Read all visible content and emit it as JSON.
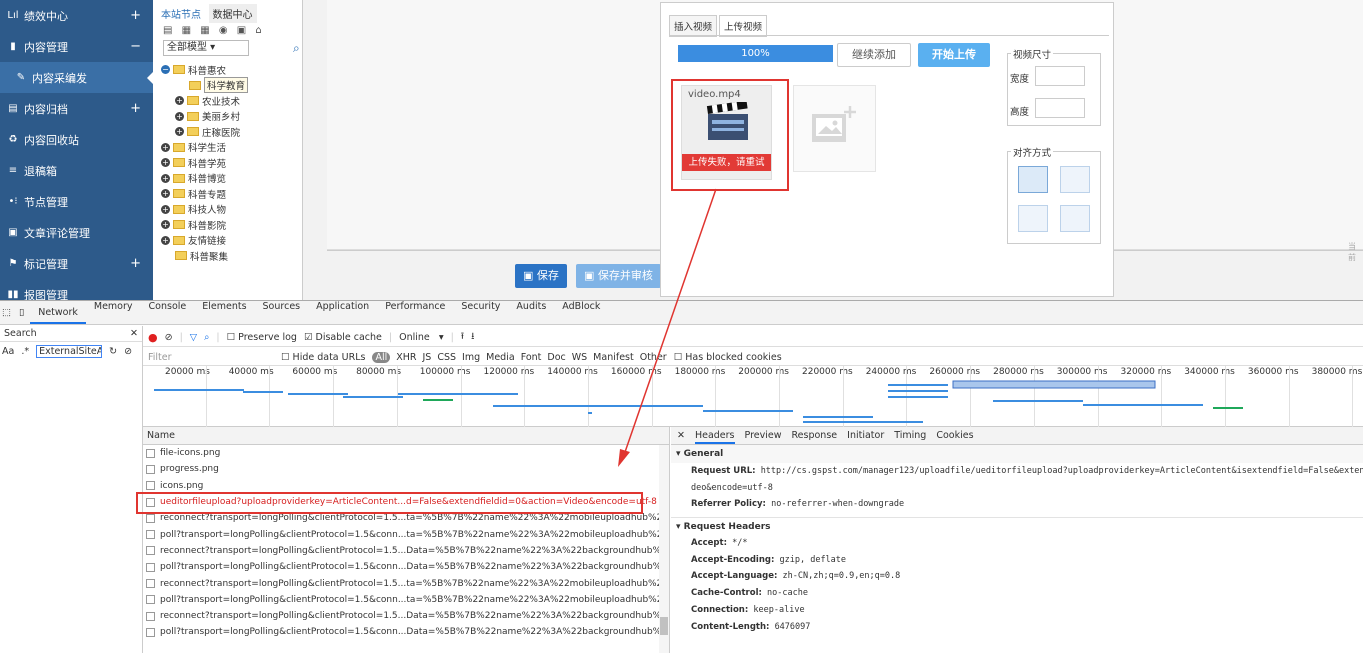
{
  "nav": {
    "items": [
      {
        "icon": "bar-chart-icon",
        "glyph": "Lıl",
        "label": "绩效中心",
        "toggle": "+"
      },
      {
        "icon": "book-icon",
        "glyph": "▮",
        "label": "内容管理",
        "toggle": "−"
      },
      {
        "icon": "wrench-icon",
        "glyph": "✎",
        "label": "内容采编发",
        "toggle": ""
      },
      {
        "icon": "archive-icon",
        "glyph": "▤",
        "label": "内容归档",
        "toggle": "+"
      },
      {
        "icon": "recycle-icon",
        "glyph": "♻",
        "label": "内容回收站",
        "toggle": ""
      },
      {
        "icon": "return-box-icon",
        "glyph": "≡",
        "label": "退稿箱",
        "toggle": ""
      },
      {
        "icon": "node-icon",
        "glyph": "•⁝",
        "label": "节点管理",
        "toggle": ""
      },
      {
        "icon": "comment-icon",
        "glyph": "▣",
        "label": "文章评论管理",
        "toggle": ""
      },
      {
        "icon": "flag-icon",
        "glyph": "⚑",
        "label": "标记管理",
        "toggle": "+"
      },
      {
        "icon": "report-icon",
        "glyph": "▮▮",
        "label": "报图管理",
        "toggle": ""
      }
    ]
  },
  "tree": {
    "tabs": [
      "本站节点",
      "数据中心"
    ],
    "tool_glyphs": "▤ ▦ ▦ ◉ ▣ ⌂",
    "model_select": "全部模型",
    "nodes": [
      {
        "label": "科普惠农",
        "btn": "−",
        "indent": 0
      },
      {
        "label": "科学教育",
        "btn": "",
        "indent": 2
      },
      {
        "label": "农业技术",
        "btn": "+",
        "indent": 1
      },
      {
        "label": "美丽乡村",
        "btn": "+",
        "indent": 1
      },
      {
        "label": "庄稼医院",
        "btn": "+",
        "indent": 1
      },
      {
        "label": "科学生活",
        "btn": "+",
        "indent": 0
      },
      {
        "label": "科普学苑",
        "btn": "+",
        "indent": 0
      },
      {
        "label": "科普博览",
        "btn": "+",
        "indent": 0
      },
      {
        "label": "科普专题",
        "btn": "+",
        "indent": 0
      },
      {
        "label": "科技人物",
        "btn": "+",
        "indent": 0
      },
      {
        "label": "科普影院",
        "btn": "+",
        "indent": 0
      },
      {
        "label": "友情链接",
        "btn": "+",
        "indent": 0
      },
      {
        "label": "科普聚集",
        "btn": "",
        "indent": 1
      }
    ]
  },
  "editor": {
    "save_label": "保存",
    "save_review_label": "保存并审核",
    "side_text": "当前"
  },
  "dialog": {
    "tabs": [
      "插入视频",
      "上传视频"
    ],
    "progress_text": "100%",
    "progress_value": 1.0,
    "continue_add": "继续添加",
    "start_upload": "开始上传",
    "file_name": "video.mp4",
    "upload_error": "上传失败，请重试",
    "size_legend": "视频尺寸",
    "width_label": "宽度",
    "height_label": "高度",
    "align_legend": "对齐方式"
  },
  "devtools": {
    "tabs": [
      "Network",
      "Memory",
      "Console",
      "Elements",
      "Sources",
      "Application",
      "Performance",
      "Security",
      "Audits",
      "AdBlock"
    ],
    "search_label": "Search",
    "search_value": "ExternalSiteAut",
    "aa": "Aa",
    "regex": ".*",
    "preserve_log": "Preserve log",
    "disable_cache": "Disable cache",
    "online": "Online",
    "filter_placeholder": "Filter",
    "hide_data_urls": "Hide data URLs",
    "filters": [
      "All",
      "XHR",
      "JS",
      "CSS",
      "Img",
      "Media",
      "Font",
      "Doc",
      "WS",
      "Manifest",
      "Other"
    ],
    "blocked_cookies": "Has blocked cookies",
    "timeline_ticks": [
      "20000 ms",
      "40000 ms",
      "60000 ms",
      "80000 ms",
      "100000 ms",
      "120000 ms",
      "140000 ms",
      "160000 ms",
      "180000 ms",
      "200000 ms",
      "220000 ms",
      "240000 ms",
      "260000 ms",
      "280000 ms",
      "300000 ms",
      "320000 ms",
      "340000 ms",
      "360000 ms",
      "380000 ms"
    ],
    "name_header": "Name",
    "requests": [
      "file-icons.png",
      "progress.png",
      "icons.png",
      "ueditorfileupload?uploadproviderkey=ArticleContent...d=False&extendfieldid=0&action=Video&encode=utf-8",
      "reconnect?transport=longPolling&clientProtocol=1.5...ta=%5B%7B%22name%22%3A%22mobileuploadhub%22%7D%5D",
      "poll?transport=longPolling&clientProtocol=1.5&conn...ta=%5B%7B%22name%22%3A%22mobileuploadhub%22%7D%5D",
      "reconnect?transport=longPolling&clientProtocol=1.5...Data=%5B%7B%22name%22%3A%22backgroundhub%22%7D%5D",
      "poll?transport=longPolling&clientProtocol=1.5&conn...Data=%5B%7B%22name%22%3A%22backgroundhub%22%7D%5D",
      "reconnect?transport=longPolling&clientProtocol=1.5...ta=%5B%7B%22name%22%3A%22mobileuploadhub%22%7D%5D",
      "poll?transport=longPolling&clientProtocol=1.5&conn...ta=%5B%7B%22name%22%3A%22mobileuploadhub%22%7D%5D",
      "reconnect?transport=longPolling&clientProtocol=1.5...Data=%5B%7B%22name%22%3A%22backgroundhub%22%7D%5D",
      "poll?transport=longPolling&clientProtocol=1.5&conn...Data=%5B%7B%22name%22%3A%22backgroundhub%22%7D%5D"
    ],
    "detail_tabs": [
      "Headers",
      "Preview",
      "Response",
      "Initiator",
      "Timing",
      "Cookies"
    ],
    "general_label": "General",
    "request_url_label": "Request URL:",
    "request_url": "http://cs.gspst.com/manager123/uploadfile/ueditorfileupload?uploadproviderkey=ArticleContent&isextendfield=False&extendf",
    "request_url_cont": "deo&encode=utf-8",
    "referrer_label": "Referrer Policy:",
    "referrer": "no-referrer-when-downgrade",
    "request_headers_label": "Request Headers",
    "headers": [
      {
        "k": "Accept:",
        "v": "*/*"
      },
      {
        "k": "Accept-Encoding:",
        "v": "gzip, deflate"
      },
      {
        "k": "Accept-Language:",
        "v": "zh-CN,zh;q=0.9,en;q=0.8"
      },
      {
        "k": "Cache-Control:",
        "v": "no-cache"
      },
      {
        "k": "Connection:",
        "v": "keep-alive"
      },
      {
        "k": "Content-Length:",
        "v": "6476097"
      }
    ]
  }
}
